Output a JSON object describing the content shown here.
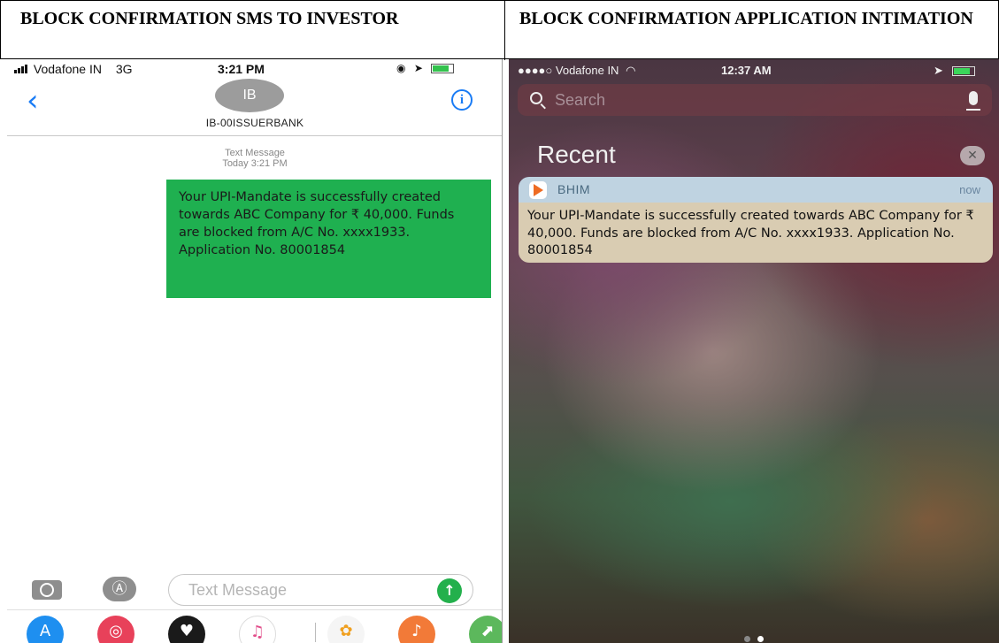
{
  "header": {
    "left_title": "BLOCK CONFIRMATION SMS TO INVESTOR",
    "right_title": "BLOCK CONFIRMATION APPLICATION INTIMATION"
  },
  "sms_screen": {
    "status_bar": {
      "carrier": "Vodafone IN",
      "network": "3G",
      "time": "3:21 PM"
    },
    "contact": {
      "avatar_initials": "IB",
      "name": "IB-00ISSUERBANK"
    },
    "message_meta": {
      "type": "Text Message",
      "timestamp": "Today 3:21 PM"
    },
    "message_text": "Your UPI-Mandate is successfully created towards ABC Company for ₹ 40,000. Funds are blocked from A/C No. xxxx1933. Application No. 80001854",
    "compose": {
      "placeholder": "Text Message"
    },
    "icons": [
      "chevron-left-icon",
      "info-icon",
      "camera-icon",
      "app-store-icon",
      "send-arrow-icon"
    ],
    "dock_apps": [
      "app-store",
      "search-images",
      "digital-touch",
      "music",
      "photos",
      "garageband",
      "maps"
    ],
    "colors": {
      "bubble": "#1fb050",
      "accent": "#1a7cf5"
    }
  },
  "notification_screen": {
    "status_bar": {
      "carrier": "Vodafone IN",
      "time": "12:37 AM"
    },
    "search": {
      "placeholder": "Search"
    },
    "section_title": "Recent",
    "notification": {
      "app_name": "BHIM",
      "time": "now",
      "text": "Your UPI-Mandate is successfully created towards ABC Company for ₹ 40,000. Funds are blocked from A/C No. xxxx1933. Application No. 80001854"
    },
    "colors": {
      "notif_header": "#bfd3e1",
      "notif_body": "#d9ccb2"
    }
  }
}
